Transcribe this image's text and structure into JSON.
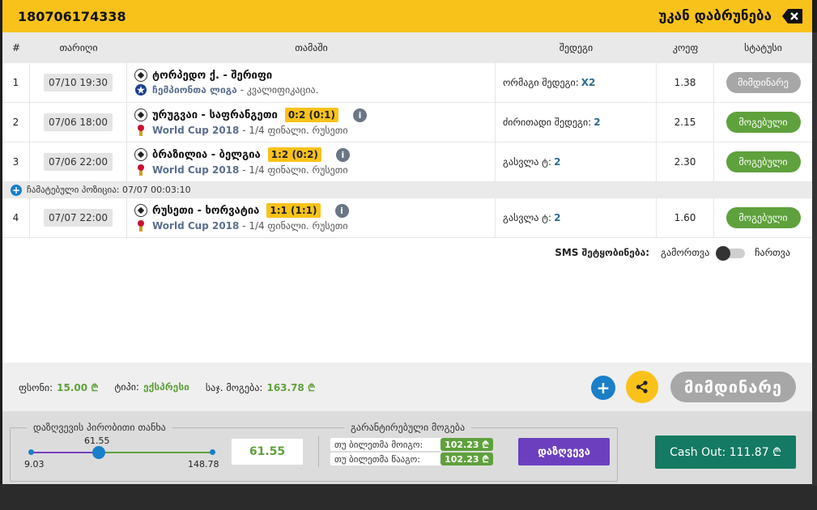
{
  "header": {
    "ticket_id": "180706174338",
    "back_label": "უკან დაბრუნება"
  },
  "table": {
    "columns": [
      "#",
      "თარიღი",
      "თამაში",
      "შედეგი",
      "კოეფ",
      "სტატუსი"
    ],
    "rows": [
      {
        "num": "1",
        "date": "07/10 19:30",
        "teams": "ტორპედო ქ. - შერიფი",
        "score": "",
        "league_name": "ჩემპიონთა ლიგა",
        "league_rest": " - კვალიფიკაცია.",
        "result_label": "ორმაგი შედეგი:",
        "result_value": "X2",
        "coef": "1.38",
        "status": "მიმდინარე"
      },
      {
        "num": "2",
        "date": "07/06 18:00",
        "teams": "ურუგვაი - საფრანგეთი",
        "score": "0:2 (0:1)",
        "league_name": "World Cup 2018",
        "league_rest": " - 1/4 ფინალი. რუსეთი",
        "result_label": "ძირითადი შედეგი:",
        "result_value": "2",
        "coef": "2.15",
        "status": "მოგებული"
      },
      {
        "num": "3",
        "date": "07/06 22:00",
        "teams": "ბრაზილია - ბელგია",
        "score": "1:2 (0:2)",
        "league_name": "World Cup 2018",
        "league_rest": " - 1/4 ფინალი. რუსეთი",
        "result_label": "გასვლა ტ:",
        "result_value": "2",
        "coef": "2.30",
        "status": "მოგებული"
      },
      {
        "num": "4",
        "date": "07/07 22:00",
        "teams": "რუსეთი - ხორვატია",
        "score": "1:1 (1:1)",
        "league_name": "World Cup 2018",
        "league_rest": " - 1/4 ფინალი. რუსეთი",
        "result_label": "გასვლა ტ:",
        "result_value": "2",
        "coef": "1.60",
        "status": "მოგებული"
      }
    ],
    "combo_note": "ჩამატებული პოზიცია: 07/07 00:03:10"
  },
  "sms": {
    "label": "SMS შეტყობინება:",
    "off": "გამორთვა",
    "on": "ჩართვა"
  },
  "summary": {
    "stake_label": "ფსონი:",
    "stake_value": "15.00 ₾",
    "type_label": "ტიპი:",
    "type_value": "ექსპრესი",
    "max_win_label": "საჯ. მოგება:",
    "max_win_value": "163.78 ₾",
    "status_button": "მიმდინარე"
  },
  "insurance": {
    "title": "დაზღვევის პირობითი თანხა",
    "current": "61.55",
    "min": "9.03",
    "max": "148.78",
    "amount": "61.55",
    "guaranteed_title": "გარანტირებული მოგება",
    "if_win_label": "თუ ბილეთმა მოიგო:",
    "if_win_value": "102.23 ₾",
    "if_lose_label": "თუ ბილეთმა წააგო:",
    "if_lose_value": "102.23 ₾",
    "insure_button": "დაზღვევა",
    "slider_fraction": 0.376
  },
  "cashout": {
    "label": "Cash Out: 111.87 ₾"
  },
  "colors": {
    "accent": "#f9c21b",
    "win": "#5fa13c",
    "blue": "#1a7fc9",
    "purple": "#6c3fbf",
    "cashout": "#147a63"
  }
}
